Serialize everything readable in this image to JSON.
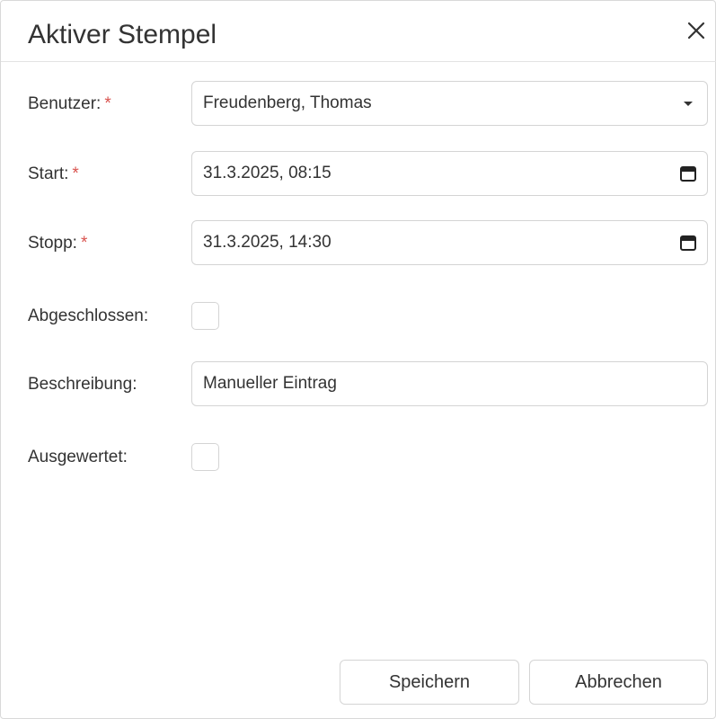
{
  "dialog": {
    "title": "Aktiver Stempel",
    "close_icon": "close-icon"
  },
  "form": {
    "user": {
      "label": "Benutzer:",
      "required_mark": "*",
      "value": "Freudenberg, Thomas",
      "icon": "caret-down-icon"
    },
    "start": {
      "label": "Start:",
      "required_mark": "*",
      "value": "31.3.2025, 08:15",
      "icon": "calendar-icon"
    },
    "stop": {
      "label": "Stopp:",
      "required_mark": "*",
      "value": "31.3.2025, 14:30",
      "icon": "calendar-icon"
    },
    "completed": {
      "label": "Abgeschlossen:",
      "checked": false
    },
    "description": {
      "label": "Beschreibung:",
      "value": "Manueller Eintrag"
    },
    "evaluated": {
      "label": "Ausgewertet:",
      "checked": false
    }
  },
  "footer": {
    "save_label": "Speichern",
    "cancel_label": "Abbrechen"
  },
  "colors": {
    "required": "#d9534f",
    "border": "#d4d4d4",
    "text": "#333333"
  }
}
